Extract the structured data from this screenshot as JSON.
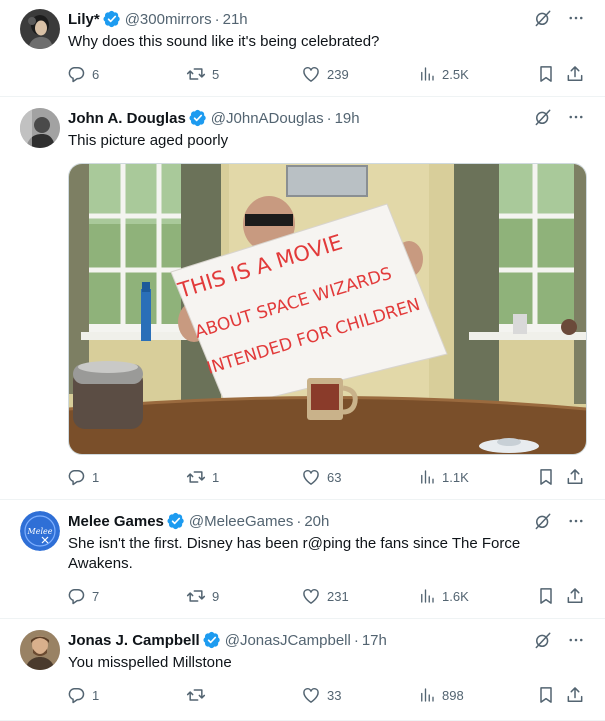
{
  "tweets": [
    {
      "display_name": "Lily*",
      "handle": "@300mirrors",
      "separator": "·",
      "time": "21h",
      "text": "Why does this sound like it's being celebrated?",
      "replies": "6",
      "reposts": "5",
      "likes": "239",
      "views": "2.5K"
    },
    {
      "display_name": "John A. Douglas",
      "handle": "@J0hnADouglas",
      "separator": "·",
      "time": "19h",
      "text": "This picture aged poorly",
      "media_sign_lines": [
        "THIS IS A MOVIE",
        "ABOUT SPACE WIZARDS",
        "INTENDED FOR CHILDREN"
      ],
      "replies": "1",
      "reposts": "1",
      "likes": "63",
      "views": "1.1K"
    },
    {
      "display_name": "Melee Games",
      "handle": "@MeleeGames",
      "separator": "·",
      "time": "20h",
      "text": "She isn't the first. Disney has been r@ping the fans since The Force Awakens.",
      "replies": "7",
      "reposts": "9",
      "likes": "231",
      "views": "1.6K"
    },
    {
      "display_name": "Jonas J. Campbell",
      "handle": "@JonasJCampbell",
      "separator": "·",
      "time": "17h",
      "text": "You misspelled Millstone",
      "replies": "1",
      "reposts": "",
      "likes": "33",
      "views": "898"
    }
  ],
  "colors": {
    "text": "#0f1419",
    "secondary": "#536471",
    "verified": "#1d9bf0",
    "divider": "#eff3f4"
  },
  "icons": {
    "verified": "verified-badge-icon",
    "grok": "grok-icon",
    "more": "more-icon",
    "reply": "reply-icon",
    "repost": "repost-icon",
    "like": "like-icon",
    "views": "views-icon",
    "bookmark": "bookmark-icon",
    "share": "share-icon"
  }
}
